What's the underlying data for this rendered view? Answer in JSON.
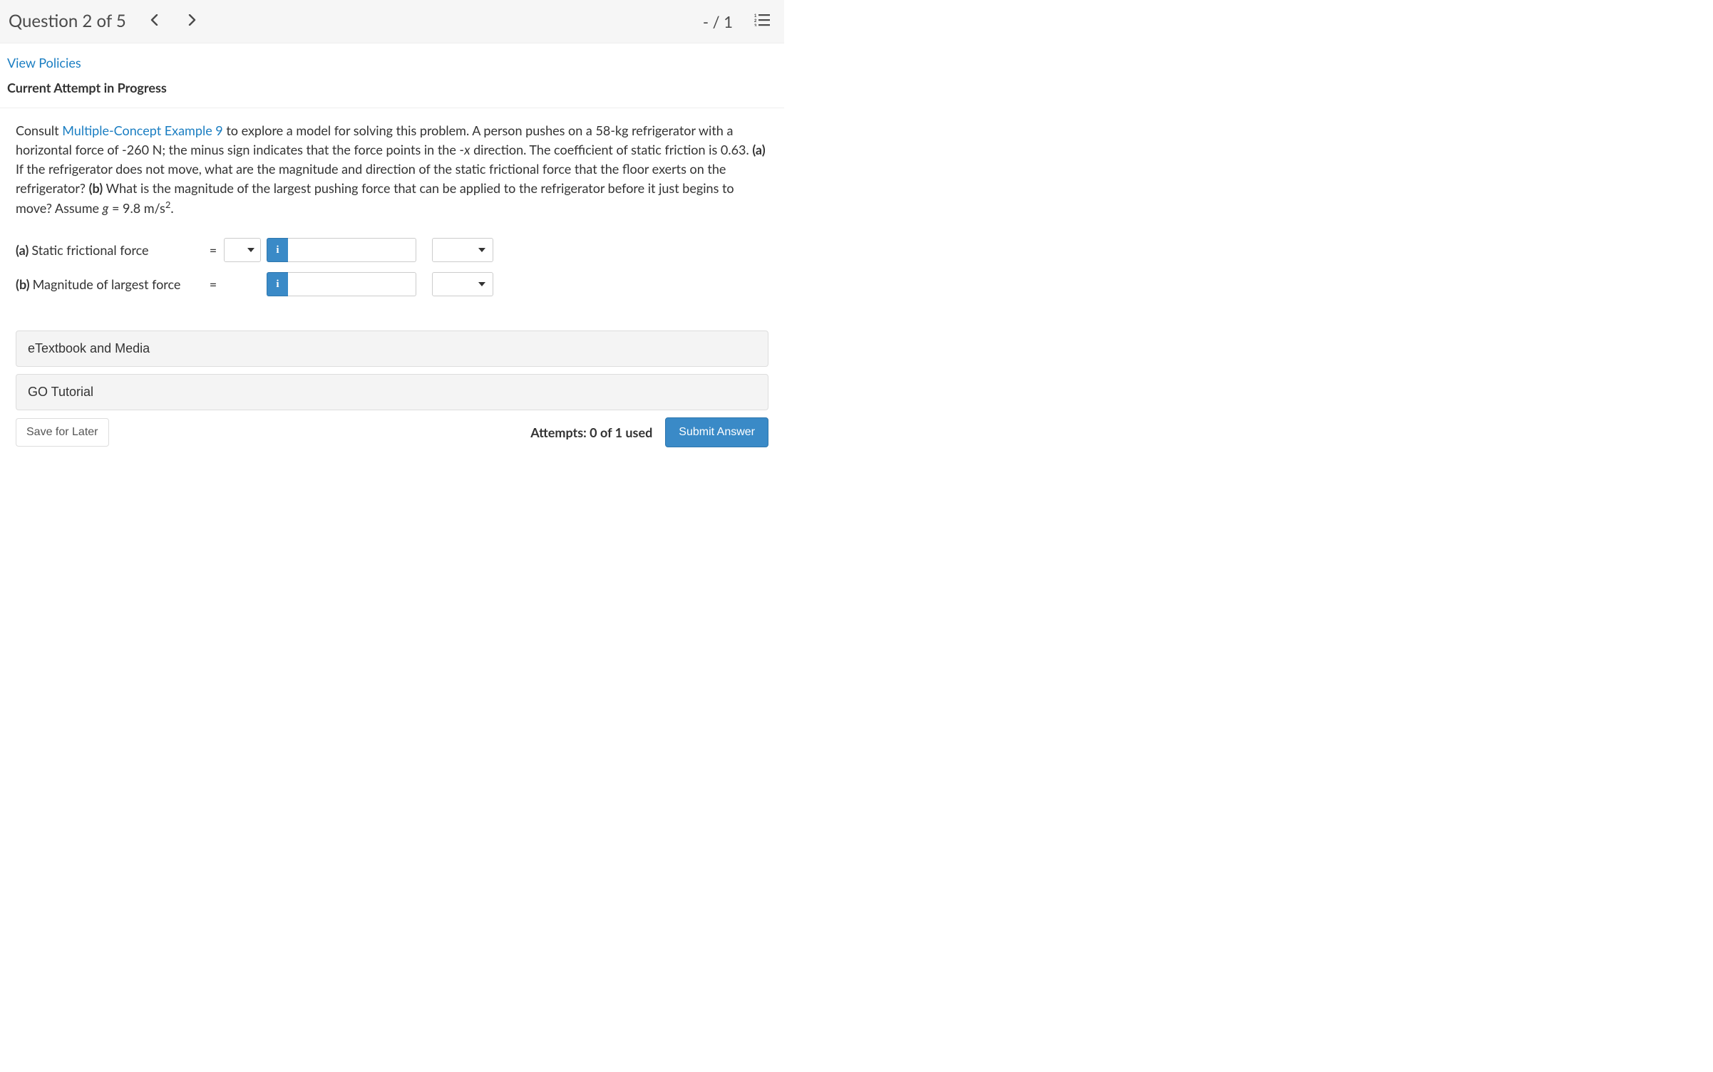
{
  "header": {
    "question_label": "Question 2 of 5",
    "score": "- / 1"
  },
  "meta": {
    "view_policies": "View Policies",
    "attempt_title": "Current Attempt in Progress"
  },
  "problem": {
    "text_pre": "Consult ",
    "example_link": "Multiple-Concept Example 9",
    "text_post_1": " to explore a model for solving this problem. A person pushes on a 58-kg refrigerator with a horizontal force of -260 N; the minus sign indicates that the force points in the -",
    "italic_var": "x",
    "text_post_2": " direction. The coefficient of static friction is 0.63. ",
    "part_a_bold": "(a)",
    "part_a_text": " If the refrigerator does not move, what are the magnitude and direction of the static frictional force that the floor exerts on the refrigerator? ",
    "part_b_bold": "(b)",
    "part_b_text": " What is the magnitude of the largest pushing force that can be applied to the refrigerator before it just begins to move? Assume ",
    "g_italic": "g",
    "g_eq": " = 9.8 m/s",
    "g_sup": "2",
    "g_end": "."
  },
  "answers": {
    "part_a": {
      "bold": "(a)",
      "label": " Static frictional force",
      "eq": "="
    },
    "part_b": {
      "bold": "(b)",
      "label": " Magnitude of largest force",
      "eq": "="
    }
  },
  "resources": {
    "etextbook": "eTextbook and Media",
    "tutorial": "GO Tutorial"
  },
  "footer": {
    "save": "Save for Later",
    "attempts": "Attempts: 0 of 1 used",
    "submit": "Submit Answer"
  }
}
